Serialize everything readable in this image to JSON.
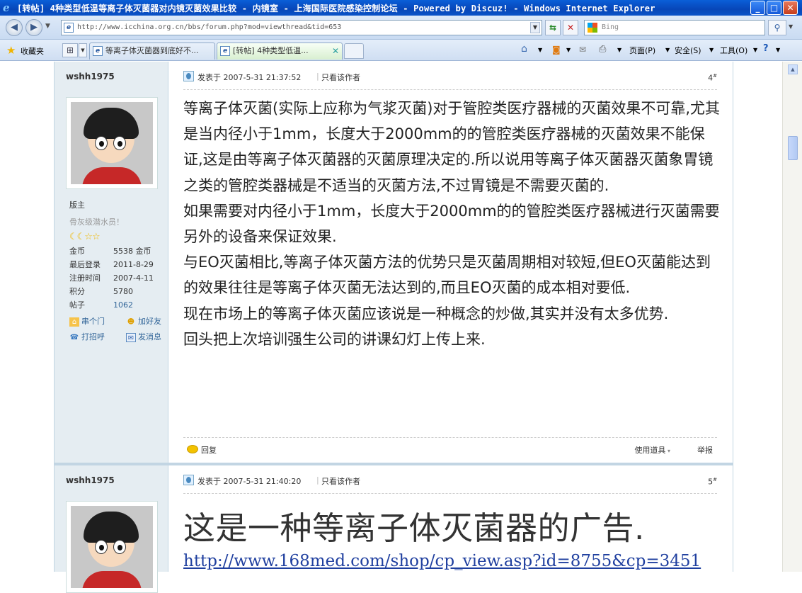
{
  "window": {
    "title": "[转帖] 4种类型低温等离子体灭菌器对内镜灭菌效果比较 - 内镜室 - 上海国际医院感染控制论坛 - Powered by Discuz! - Windows Internet Explorer"
  },
  "address_bar": {
    "url": "http://www.icchina.org.cn/bbs/forum.php?mod=viewthread&tid=653",
    "search_placeholder": "Bing"
  },
  "favorites_bar": {
    "favorites_label": "收藏夹",
    "tabs": [
      {
        "label": "等离子体灭菌器到底好不..."
      },
      {
        "label": "[转帖] 4种类型低温..."
      }
    ],
    "commands": {
      "page": "页面(P)",
      "safety": "安全(S)",
      "tools": "工具(O)"
    }
  },
  "posts": [
    {
      "author": "wshh1975",
      "rank": "版主",
      "rank_title": "骨灰级潜水员！",
      "stats": [
        {
          "label": "金币",
          "value": "5538 金币"
        },
        {
          "label": "最后登录",
          "value": "2011-8-29"
        },
        {
          "label": "注册时间",
          "value": "2007-4-11"
        },
        {
          "label": "积分",
          "value": "5780"
        },
        {
          "label": "帖子",
          "value": "1062"
        }
      ],
      "actions": {
        "visit": "串个门",
        "add_friend": "加好友",
        "greet": "打招呼",
        "message": "发消息"
      },
      "time": "发表于 2007-5-31 21:37:52",
      "only_author": "只看该作者",
      "floor": "4",
      "content": [
        "等离子体灭菌(实际上应称为气浆灭菌)对于管腔类医疗器械的灭菌效果不可靠,尤其是当内径小于1mm，长度大于2000mm的的管腔类医疗器械的灭菌效果不能保证,这是由等离子体灭菌器的灭菌原理决定的.所以说用等离子体灭菌器灭菌象胃镜之类的管腔类器械是不适当的灭菌方法,不过胃镜是不需要灭菌的.",
        "如果需要对内径小于1mm，长度大于2000mm的的管腔类医疗器械进行灭菌需要另外的设备来保证效果.",
        "与EO灭菌相比,等离子体灭菌方法的优势只是灭菌周期相对较短,但EO灭菌能达到的效果往往是等离子体灭菌无法达到的,而且EO灭菌的成本相对要低.",
        "现在市场上的等离子体灭菌应该说是一种概念的炒做,其实并没有太多优势.",
        "回头把上次培训强生公司的讲课幻灯上传上来."
      ],
      "footer": {
        "reply": "回复",
        "tools": "使用道具",
        "report": "举报"
      }
    },
    {
      "author": "wshh1975",
      "time": "发表于 2007-5-31 21:40:20",
      "only_author": "只看该作者",
      "floor": "5",
      "title": "这是一种等离子体灭菌器的广告.",
      "link": "http://www.168med.com/shop/cp_view.asp?id=8755&cp=3451"
    }
  ]
}
